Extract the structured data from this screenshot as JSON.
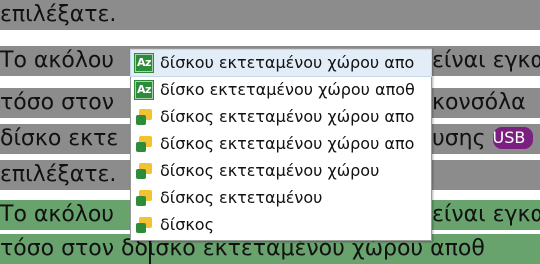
{
  "document": {
    "lines": [
      {
        "text": "επιλέξατε.",
        "bg": "grey"
      },
      {
        "text": "Το ακόλου",
        "rest": "είναι εγκα",
        "bg": "grey"
      },
      {
        "text": "τόσο στον",
        "rest": "κονσόλα",
        "bg": "grey"
      },
      {
        "text": "δίσκο εκτε",
        "rest": "υσης",
        "badge": "USB",
        "bg": "grey"
      },
      {
        "text": "επιλέξατε.",
        "bg": "grey"
      },
      {
        "text": "Το ακόλου",
        "rest": "είναι εγκα",
        "bg": "green"
      },
      {
        "text": "τόσο στον δδίσκο εκτεταμένου χώρου αποθ",
        "bg": "green"
      }
    ]
  },
  "autocomplete": {
    "items": [
      {
        "label": "δίσκου εκτεταμένου χώρου απο",
        "icon": "az-icon",
        "selected": true
      },
      {
        "label": "δίσκο εκτεταμένου χώρου αποθ",
        "icon": "az-icon",
        "selected": false
      },
      {
        "label": "δίσκος εκτεταμένου χώρου απο",
        "icon": "document-icon",
        "selected": false
      },
      {
        "label": "δίσκος εκτεταμένου χώρου απο",
        "icon": "document-icon",
        "selected": false
      },
      {
        "label": "δίσκος εκτεταμένου χώρου",
        "icon": "document-icon",
        "selected": false
      },
      {
        "label": "δίσκος εκτεταμένου",
        "icon": "document-icon",
        "selected": false
      },
      {
        "label": "δίσκος",
        "icon": "document-icon",
        "selected": false
      }
    ]
  },
  "colors": {
    "grey_bg": "#8c8c8c",
    "green_bg": "#68a26d",
    "badge": "#7b1f80",
    "selection": "#e3edf8"
  }
}
